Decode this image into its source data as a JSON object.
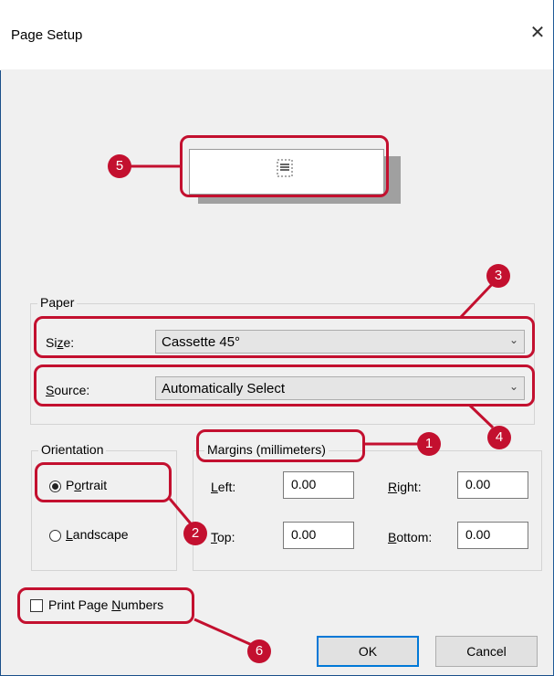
{
  "window": {
    "title": "Page Setup",
    "close_glyph": "✕"
  },
  "paper": {
    "legend": "Paper",
    "size": {
      "label": "Size:",
      "value": "Cassette 45°"
    },
    "source": {
      "label": "Source:",
      "value": "Automatically Select"
    },
    "dropdown_glyph": "⌄"
  },
  "orientation": {
    "legend": "Orientation",
    "portrait": "Portrait",
    "landscape": "Landscape",
    "selected": "Portrait"
  },
  "margins": {
    "legend": "Margins (millimeters)",
    "left": {
      "label": "Left:",
      "value": "0.00"
    },
    "right": {
      "label": "Right:",
      "value": "0.00"
    },
    "top": {
      "label": "Top:",
      "value": "0.00"
    },
    "bottom": {
      "label": "Bottom:",
      "value": "0.00"
    }
  },
  "print_page_numbers": {
    "label": "Print Page Numbers",
    "checked": false
  },
  "buttons": {
    "ok": "OK",
    "cancel": "Cancel"
  },
  "callouts": [
    "1",
    "2",
    "3",
    "4",
    "5",
    "6"
  ],
  "colors": {
    "callout": "#c3102f",
    "default_button_border": "#0078d7",
    "dialog_bg": "#f0f0f0"
  }
}
